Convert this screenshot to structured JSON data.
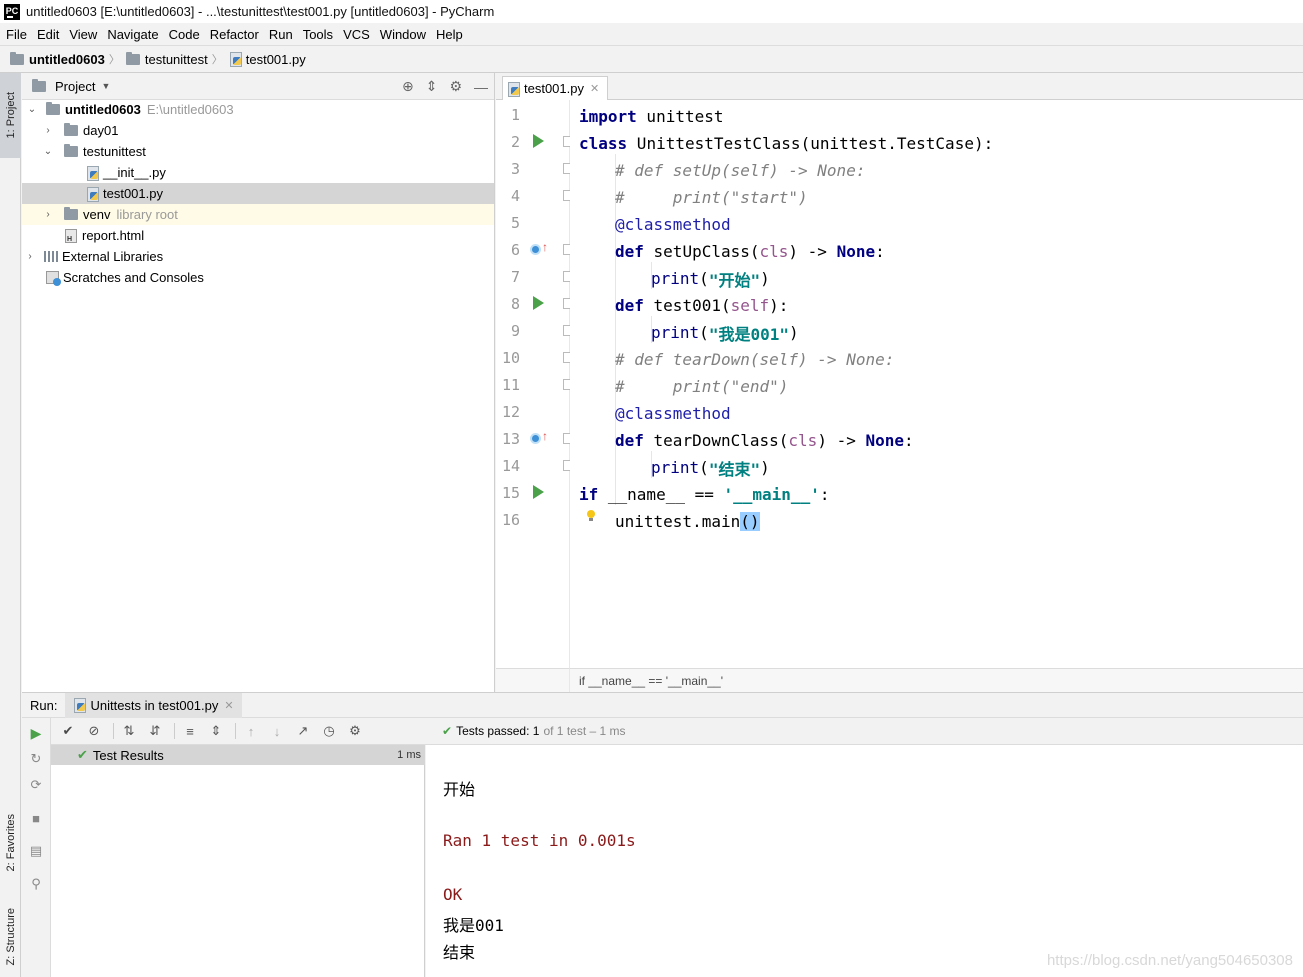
{
  "window": {
    "app_icon": "PC",
    "title": "untitled0603 [E:\\untitled0603] - ...\\testunittest\\test001.py [untitled0603] - PyCharm"
  },
  "menu": [
    "File",
    "Edit",
    "View",
    "Navigate",
    "Code",
    "Refactor",
    "Run",
    "Tools",
    "VCS",
    "Window",
    "Help"
  ],
  "breadcrumb": [
    "untitled0603",
    "testunittest",
    "test001.py"
  ],
  "side_tabs": {
    "project": "1: Project",
    "favorites": "2: Favorites",
    "structure": "Z: Structure"
  },
  "project_panel": {
    "title": "Project",
    "tree": [
      {
        "label": "untitled0603",
        "hint": "E:\\untitled0603"
      },
      {
        "label": "day01"
      },
      {
        "label": "testunittest"
      },
      {
        "label": "__init__.py"
      },
      {
        "label": "test001.py"
      },
      {
        "label": "venv",
        "hint": "library root"
      },
      {
        "label": "report.html"
      },
      {
        "label": "External Libraries"
      },
      {
        "label": "Scratches and Consoles"
      }
    ]
  },
  "editor": {
    "tab": "test001.py",
    "line_numbers": [
      "1",
      "2",
      "3",
      "4",
      "5",
      "6",
      "7",
      "8",
      "9",
      "10",
      "11",
      "12",
      "13",
      "14",
      "15",
      "16"
    ],
    "lines": [
      {
        "kw": "import",
        "rest": " unittest"
      },
      {
        "kw": "class",
        "rest": " UnittestTestClass(unittest.TestCase):"
      },
      {
        "comment": "# def setUp(self) -> None:"
      },
      {
        "comment": "#     print(\"start\")"
      },
      {
        "decorator": "@classmethod"
      },
      {
        "kw": "def",
        "name": " setUpClass(",
        "self": "cls",
        "tail": ") -> ",
        "kw2": "None",
        "end": ":"
      },
      {
        "builtin": "print",
        "open": "(",
        "str": "\"开始\"",
        "close": ")"
      },
      {
        "kw": "def",
        "name": " test001(",
        "self": "self",
        "tail": "):"
      },
      {
        "builtin": "print",
        "open": "(",
        "str": "\"我是001\"",
        "close": ")"
      },
      {
        "comment": "# def tearDown(self) -> None:"
      },
      {
        "comment": "#     print(\"end\")"
      },
      {
        "decorator": "@classmethod"
      },
      {
        "kw": "def",
        "name": " tearDownClass(",
        "self": "cls",
        "tail": ") -> ",
        "kw2": "None",
        "end": ":"
      },
      {
        "builtin": "print",
        "open": "(",
        "str": "\"结束\"",
        "close": ")"
      },
      {
        "kw": "if",
        "rest": " __name__ == ",
        "str": "'__main__'",
        "end": ":"
      },
      {
        "rest": "unittest.main",
        "paren": "()"
      }
    ],
    "status_breadcrumb": "if __name__ == '__main__'"
  },
  "run_panel": {
    "label": "Run:",
    "tab": "Unittests in test001.py",
    "tests_passed_label": "Tests passed:",
    "tests_passed_count": "1",
    "tests_passed_detail": "of 1 test – 1 ms",
    "results_root": "Test Results",
    "results_time": "1 ms",
    "console": [
      {
        "text": "开始",
        "kind": "out"
      },
      {
        "text": "",
        "kind": "out"
      },
      {
        "text": "Ran 1 test in 0.001s",
        "kind": "err"
      },
      {
        "text": "",
        "kind": "out"
      },
      {
        "text": "OK",
        "kind": "err"
      },
      {
        "text": "我是001",
        "kind": "out"
      },
      {
        "text": "结束",
        "kind": "out"
      }
    ],
    "watermark": "https://blog.csdn.net/yang504650308"
  },
  "colors": {
    "keyword": "#000080",
    "comment": "#808080",
    "string": "#008080",
    "self": "#94558d",
    "run_icon": "#4aa14a",
    "stderr": "#8a1a1a"
  }
}
